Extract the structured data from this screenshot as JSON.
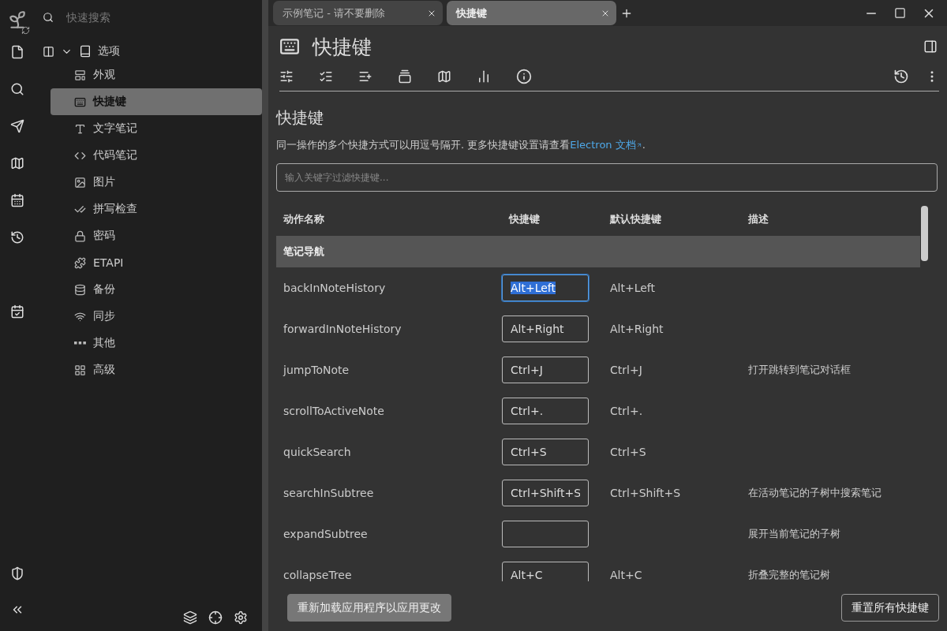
{
  "sidebar": {
    "search": {
      "placeholder": "快速搜索"
    },
    "tree": {
      "label": "选项",
      "expanded": true,
      "children": [
        {
          "label": "外观",
          "selected": false
        },
        {
          "label": "快捷键",
          "selected": true
        },
        {
          "label": "文字笔记",
          "selected": false
        },
        {
          "label": "代码笔记",
          "selected": false
        },
        {
          "label": "图片",
          "selected": false
        },
        {
          "label": "拼写检查",
          "selected": false
        },
        {
          "label": "密码",
          "selected": false
        },
        {
          "label": "ETAPI",
          "selected": false
        },
        {
          "label": "备份",
          "selected": false
        },
        {
          "label": "同步",
          "selected": false
        },
        {
          "label": "其他",
          "selected": false
        },
        {
          "label": "高级",
          "selected": false
        }
      ]
    }
  },
  "tabs": [
    {
      "label": "示例笔记 - 请不要删除",
      "selected": false
    },
    {
      "label": "快捷键",
      "selected": true
    }
  ],
  "note": {
    "title": "快捷键"
  },
  "section": {
    "heading": "快捷键",
    "intro": "同一操作的多个快捷方式可以用逗号隔开. 更多快捷键设置请查看",
    "link": "Electron 文档",
    "after": ".",
    "filter": {
      "placeholder": "输入关键字过滤快捷键..."
    }
  },
  "table": {
    "columns": [
      "动作名称",
      "快捷键",
      "默认快捷键",
      "描述"
    ],
    "rows": [
      {
        "kind": "group",
        "name": "笔记导航"
      },
      {
        "kind": "action",
        "name": "backInNoteHistory",
        "shortcut": "Alt+Left",
        "default": "Alt+Left",
        "focused": true
      },
      {
        "kind": "action",
        "name": "forwardInNoteHistory",
        "shortcut": "Alt+Right",
        "default": "Alt+Right",
        "focused": false
      },
      {
        "kind": "action",
        "name": "jumpToNote",
        "shortcut": "Ctrl+J",
        "default": "Ctrl+J",
        "description": "打开跳转到笔记对话框",
        "focused": false
      },
      {
        "kind": "action",
        "name": "scrollToActiveNote",
        "shortcut": "Ctrl+.",
        "default": "Ctrl+.",
        "focused": false
      },
      {
        "kind": "action",
        "name": "quickSearch",
        "shortcut": "Ctrl+S",
        "default": "Ctrl+S",
        "focused": false
      },
      {
        "kind": "action",
        "name": "searchInSubtree",
        "shortcut": "Ctrl+Shift+S",
        "default": "Ctrl+Shift+S",
        "description": "在活动笔记的子树中搜索笔记",
        "focused": false
      },
      {
        "kind": "action",
        "name": "expandSubtree",
        "description": "展开当前笔记的子树",
        "focused": false
      },
      {
        "kind": "action",
        "name": "collapseTree",
        "shortcut": "Alt+C",
        "default": "Alt+C",
        "description": "折叠完整的笔记树",
        "focused": false
      }
    ]
  },
  "footer": {
    "reload": "重新加载应用程序以应用更改",
    "reset": "重置所有快捷键"
  }
}
